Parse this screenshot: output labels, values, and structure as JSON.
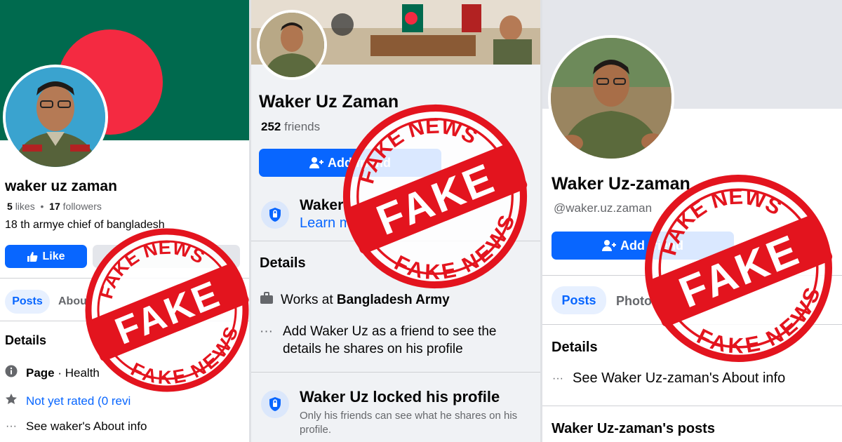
{
  "panel1": {
    "name": "waker uz zaman",
    "likes_count": "5",
    "likes_label": "likes",
    "separator": "•",
    "followers_count": "17",
    "followers_label": "followers",
    "bio": "18 th armye chief of bangladesh",
    "like_button": "Like",
    "tabs": [
      "Posts",
      "About"
    ],
    "details_title": "Details",
    "detail_page_label": "Page",
    "detail_page_rest": " · Health",
    "detail_rating": "Not yet rated (0 revi",
    "detail_about": "See waker's About info",
    "colors": {
      "flag_green": "#006a4e",
      "flag_red": "#f42a41",
      "accent": "#0866ff"
    }
  },
  "panel2": {
    "name": "Waker Uz Zaman",
    "friends_count": "252",
    "friends_label": "friends",
    "add_friend": "Add friend",
    "lock_title": "Waker",
    "lock_link": "Learn m",
    "details_title": "Details",
    "works_prefix": "Works at ",
    "works_org": "Bangladesh Army",
    "add_friend_note": "Add Waker Uz as a friend to see the details he shares on his profile",
    "locked_title": "Waker Uz locked his profile",
    "locked_subtitle": "Only his friends can see what he shares on his profile."
  },
  "panel3": {
    "name": "Waker Uz-zaman",
    "handle": "@waker.uz.zaman",
    "add_friend": "Add friend",
    "tabs": [
      "Posts",
      "Photos"
    ],
    "details_title": "Details",
    "about_link": "See Waker Uz-zaman's About info",
    "posts_title": "Waker Uz-zaman's posts"
  },
  "stamp": {
    "top_text": "FAKE NEWS",
    "center_text": "FAKE",
    "bottom_text": "FAKE NEWS",
    "color": "#e3141e"
  },
  "icons": {
    "thumb": "thumbs-up-icon",
    "add_person": "add-person-icon",
    "lock": "lock-shield-icon",
    "info": "info-icon",
    "star": "star-icon",
    "more": "more-dots-icon",
    "briefcase": "briefcase-icon"
  }
}
